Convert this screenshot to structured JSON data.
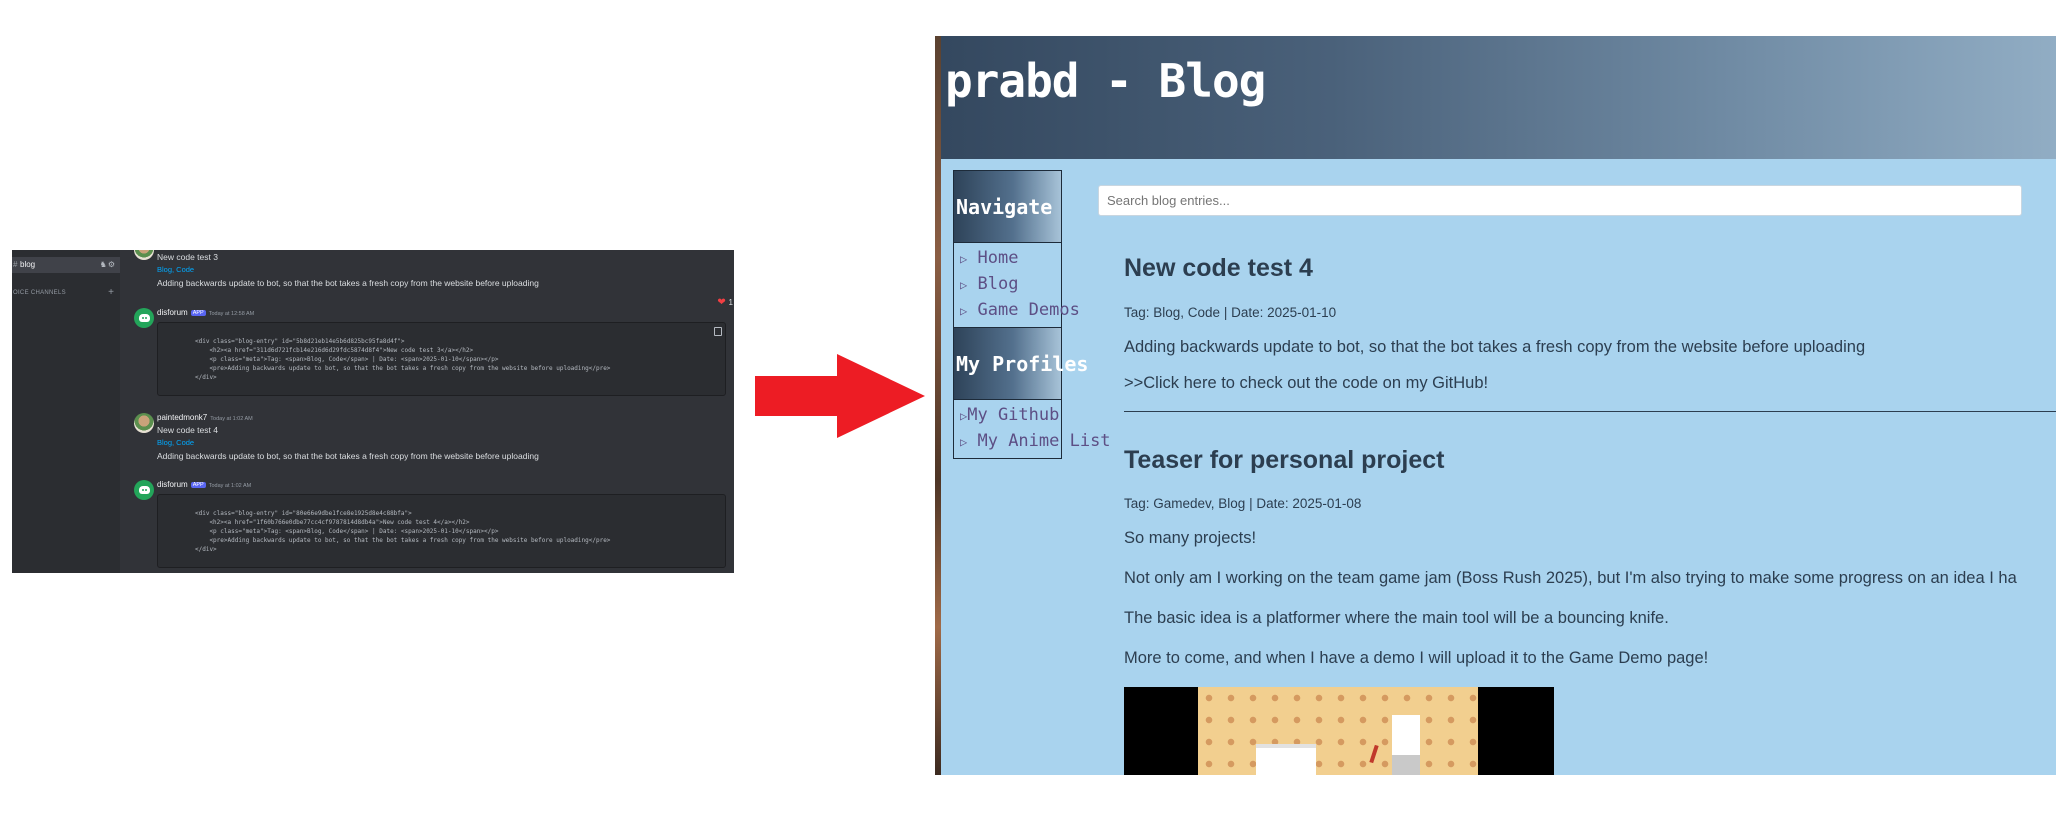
{
  "discord": {
    "channel": {
      "name": "blog"
    },
    "voice_channels_label": "OICE CHANNELS",
    "messages": [
      {
        "content": "New code test 3",
        "tags": "Blog, Code",
        "description": "Adding backwards update to bot, so that the bot takes a fresh copy from the website before uploading"
      },
      {
        "author": "disforum",
        "badge": "APP",
        "time": "Today at 12:58 AM",
        "code": [
          "<div class=\"blog-entry\" id=\"5b8d21eb14e5b6d825bc95fa8d4f\">",
          "    <h2><a href=\"311d6d721fcb14e216d6d29fdc5874d8f4\">New code test 3</a></h2>",
          "    <p class=\"meta\">Tag: <span>Blog, Code</span> | Date: <span>2025-01-10</span></p>",
          "    <pre>Adding backwards update to bot, so that the bot takes a fresh copy from the website before uploading</pre>",
          "</div>"
        ]
      },
      {
        "author": "paintedmonk7",
        "time": "Today at 1:02 AM",
        "content": "New code test 4",
        "tags": "Blog, Code",
        "description": "Adding backwards update to bot, so that the bot takes a fresh copy from the website before uploading"
      },
      {
        "author": "disforum",
        "badge": "APP",
        "time": "Today at 1:02 AM",
        "code": [
          "<div class=\"blog-entry\" id=\"80e66e9dbe1fce8e1925d8e4c88bfa\">",
          "    <h2><a href=\"1f60b766e0dbe77cc4cf9787814d8db4a\">New code test 4</a></h2>",
          "    <p class=\"meta\">Tag: <span>Blog, Code</span> | Date: <span>2025-01-10</span></p>",
          "    <pre>Adding backwards update to bot, so that the bot takes a fresh copy from the website before uploading</pre>",
          "</div>"
        ]
      }
    ],
    "reaction": {
      "emoji": "❤",
      "count": "1"
    }
  },
  "blog": {
    "title": "prabd - Blog",
    "nav": {
      "heading": "Navigate",
      "items": [
        "Home",
        "Blog",
        "Game Demos"
      ]
    },
    "profiles": {
      "heading": "My Profiles",
      "items": [
        "My Github",
        "My Anime List"
      ]
    },
    "search_placeholder": "Search blog entries...",
    "posts": [
      {
        "title": "New code test 4",
        "meta": "Tag: Blog, Code | Date: 2025-01-10",
        "paragraphs": [
          "Adding backwards update to bot, so that the bot takes a fresh copy from the website before uploading",
          ">>Click here to check out the code on my GitHub!"
        ]
      },
      {
        "title": "Teaser for personal project",
        "meta": "Tag: Gamedev, Blog | Date: 2025-01-08",
        "paragraphs": [
          "So many projects!",
          "Not only am I working on the team game jam (Boss Rush 2025), but I'm also trying to make some progress on an idea I ha",
          "The basic idea is a platformer where the main tool will be a bouncing knife.",
          "More to come, and when I have a demo I will upload it to the Game Demo page!"
        ]
      }
    ]
  },
  "colors": {
    "arrow": "#ed1c24",
    "blog_bg": "#a9d3ee",
    "discord_bg": "#313338",
    "text_dark": "#2c3e50"
  }
}
